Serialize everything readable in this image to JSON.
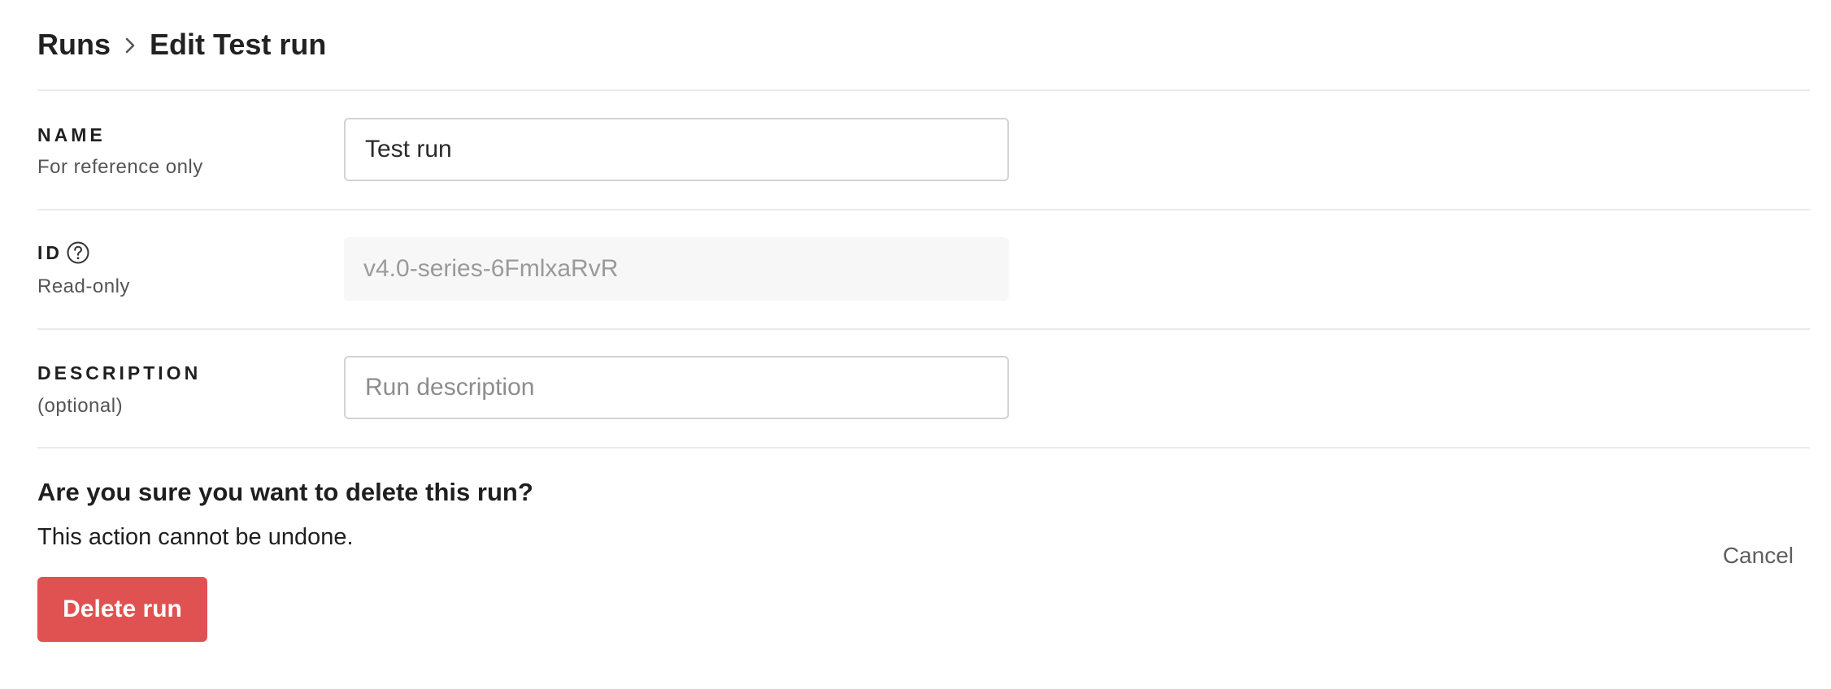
{
  "breadcrumb": {
    "parent": "Runs",
    "current": "Edit Test run"
  },
  "fields": {
    "name": {
      "label": "NAME",
      "hint": "For reference only",
      "value": "Test run"
    },
    "id": {
      "label": "ID",
      "hint": "Read-only",
      "value": "v4.0-series-6FmlxaRvR"
    },
    "description": {
      "label": "DESCRIPTION",
      "hint": "(optional)",
      "value": "",
      "placeholder": "Run description"
    }
  },
  "delete_confirm": {
    "question": "Are you sure you want to delete this run?",
    "warning": "This action cannot be undone.",
    "delete_label": "Delete run",
    "cancel_label": "Cancel"
  },
  "colors": {
    "danger": "#e05252",
    "divider": "#ebebeb",
    "readonly_bg": "#f7f7f7"
  }
}
